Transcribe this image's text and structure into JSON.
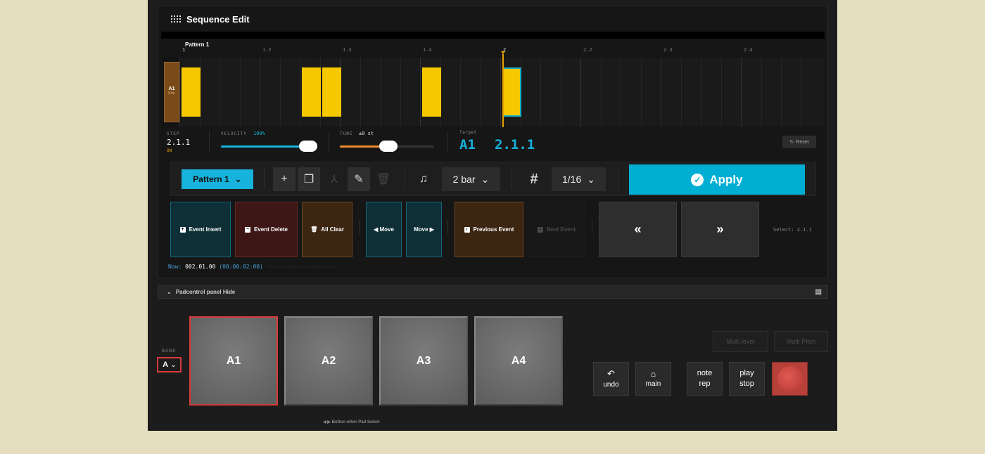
{
  "header": {
    "title": "Sequence Edit"
  },
  "timeline": {
    "pattern_name": "Pattern 1",
    "ticks": [
      {
        "label": "1",
        "major": true
      },
      {
        "label": "1.2",
        "major": false
      },
      {
        "label": "1.3",
        "major": false
      },
      {
        "label": "1.4",
        "major": false
      },
      {
        "label": "2",
        "major": true
      },
      {
        "label": "2.2",
        "major": false
      },
      {
        "label": "2.3",
        "major": false
      },
      {
        "label": "2.4",
        "major": false
      }
    ],
    "track": {
      "pad": "A1",
      "name": "Kick"
    }
  },
  "params": {
    "step_label": "STEP",
    "step_value": "2.1.1",
    "step_state": "ON",
    "velocity_label": "VELOCITY",
    "velocity_value": "100%",
    "velocity_level": 1.0,
    "tune_label": "TUNE",
    "tune_value": "±0 st",
    "target_label": "Target",
    "target_pad": "A1",
    "target_pos": "2.1.1",
    "reset_label": "Reset"
  },
  "toolbar": {
    "pattern_select": "Pattern 1",
    "length_select": "2 bar",
    "quantize_select": "1/16",
    "apply_label": "Apply"
  },
  "events": {
    "insert": "Event Insert",
    "delete": "Event Delete",
    "clear": "All Clear",
    "move_left": "◀ Move",
    "move_right": "Move ▶",
    "previous": "Previous Event",
    "next": "Next Event",
    "rewind": "«",
    "forward": "»",
    "select_status": "Select: 2.1.1"
  },
  "now": {
    "label": "Now:",
    "position": "002.01.00",
    "time": "(00:00:02:00)",
    "dashes": "--------------------"
  },
  "padcontrol": {
    "toggle_label": "Padcontrol panel Hide",
    "bank_label": "BANK",
    "bank_value": "A",
    "pads": [
      "A1",
      "A2",
      "A3",
      "A4"
    ],
    "hint": "◀ ▶ Button other Pad Select",
    "multi_level": "Multi level",
    "multi_pitch": "Multi Pitch",
    "undo": "undo",
    "main": "main",
    "note_rep_1": "note",
    "note_rep_2": "rep",
    "play_1": "play",
    "play_2": "stop"
  },
  "colors": {
    "accent": "#00aed4",
    "step": "#f6c800",
    "record": "#b8403a",
    "selected_border": "#d83a3a"
  }
}
